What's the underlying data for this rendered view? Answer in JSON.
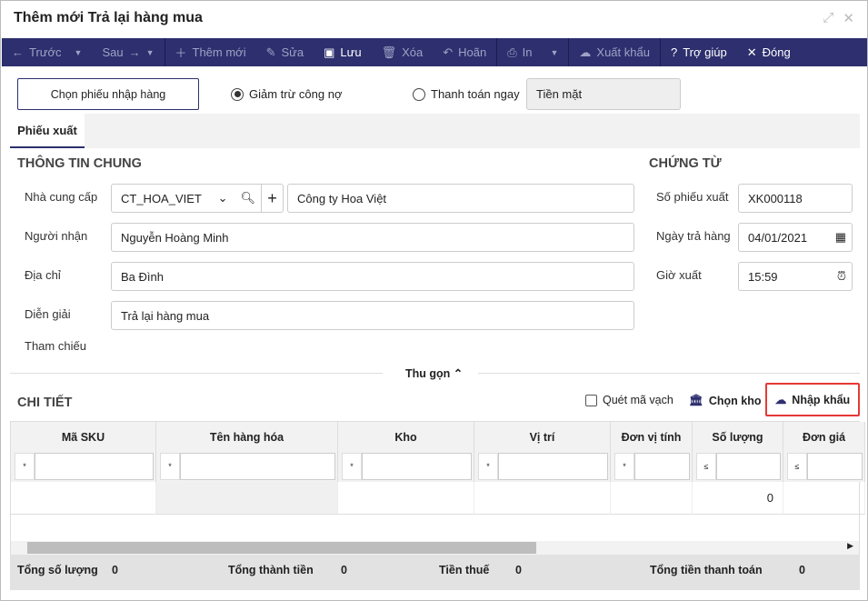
{
  "window": {
    "title": "Thêm mới Trả lại hàng mua"
  },
  "toolbar": [
    {
      "label": "Trước",
      "icon": "arrow-left-icon",
      "dropdown": true,
      "enabled": false
    },
    {
      "label": "Sau",
      "icon": "arrow-right-icon",
      "dropdown": true,
      "enabled": false
    },
    {
      "label": "Thêm mới",
      "icon": "plus-icon",
      "enabled": false
    },
    {
      "label": "Sửa",
      "icon": "pencil-icon",
      "enabled": false
    },
    {
      "label": "Lưu",
      "icon": "save-icon",
      "enabled": true
    },
    {
      "label": "Xóa",
      "icon": "trash-icon",
      "enabled": false
    },
    {
      "label": "Hoãn",
      "icon": "undo-icon",
      "enabled": false
    },
    {
      "label": "In",
      "icon": "printer-icon",
      "dropdown": true,
      "enabled": false
    },
    {
      "label": "Xuất khẩu",
      "icon": "cloud-download-icon",
      "enabled": false
    },
    {
      "label": "Trợ giúp",
      "icon": "help-icon",
      "enabled": true
    },
    {
      "label": "Đóng",
      "icon": "close-icon",
      "enabled": true
    }
  ],
  "top": {
    "choose_receipt": "Chọn phiếu nhập hàng",
    "radio1": "Giảm trừ công nợ",
    "radio2": "Thanh toán ngay",
    "payment_method": "Tiền mặt"
  },
  "tab": "Phiếu xuất",
  "general": {
    "heading": "THÔNG TIN CHUNG",
    "supplier_label": "Nhà cung cấp",
    "supplier_code": "CT_HOA_VIET",
    "supplier_name": "Công ty Hoa Việt",
    "receiver_label": "Người nhận",
    "receiver": "Nguyễn Hoàng Minh",
    "address_label": "Địa chỉ",
    "address": "Ba Đình",
    "desc_label": "Diễn giải",
    "desc": "Trả lại hàng mua",
    "ref_label": "Tham chiếu"
  },
  "voucher": {
    "heading": "CHỨNG TỪ",
    "no_label": "Số phiếu xuất",
    "no": "XK000118",
    "date_label": "Ngày trả hàng",
    "date": "04/01/2021",
    "time_label": "Giờ xuất",
    "time": "15:59"
  },
  "collapse": "Thu gọn",
  "detail": {
    "heading": "CHI TIẾT",
    "barcode": "Quét mã vạch",
    "choose_wh": "Chọn kho",
    "import": "Nhập khẩu",
    "columns": [
      "Mã SKU",
      "Tên hàng hóa",
      "Kho",
      "Vị trí",
      "Đơn vị tính",
      "Số lượng",
      "Đơn giá"
    ],
    "filter_ops": [
      "*",
      "*",
      "*",
      "*",
      "*",
      "≤",
      "≤"
    ],
    "row": [
      "",
      "",
      "",
      "",
      "",
      "0",
      ""
    ]
  },
  "totals": {
    "qty_label": "Tổng số lượng",
    "qty": "0",
    "amount_label": "Tổng thành tiền",
    "amount": "0",
    "tax_label": "Tiền thuế",
    "tax": "0",
    "pay_label": "Tổng tiền thanh toán",
    "pay": "0"
  },
  "colors": {
    "toolbar": "#2d2f6e",
    "highlight": "#e53935"
  }
}
